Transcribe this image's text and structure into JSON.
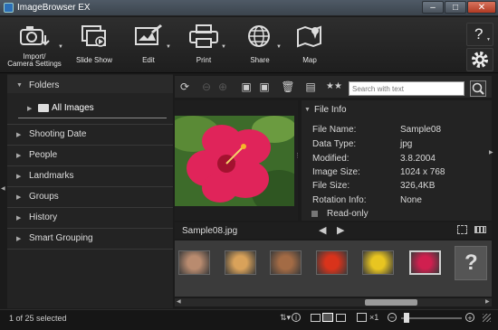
{
  "window": {
    "title": "ImageBrowser EX"
  },
  "toolbar": {
    "import_line1": "Import/",
    "import_line2": "Camera Settings",
    "slideshow": "Slide Show",
    "edit": "Edit",
    "print": "Print",
    "share": "Share",
    "map": "Map",
    "help": "?"
  },
  "sidebar": {
    "folders": "Folders",
    "all_images": "All Images",
    "items": [
      "Shooting Date",
      "People",
      "Landmarks",
      "Groups",
      "History",
      "Smart Grouping"
    ]
  },
  "search": {
    "placeholder": "Search with text"
  },
  "file_info": {
    "header": "File Info",
    "rows": [
      {
        "label": "File Name:",
        "value": "Sample08"
      },
      {
        "label": "Data Type:",
        "value": "jpg"
      },
      {
        "label": "Modified:",
        "value": "3.8.2004"
      },
      {
        "label": "Image Size:",
        "value": "1024 x 768"
      },
      {
        "label": "File Size:",
        "value": "326,4KB"
      },
      {
        "label": "Rotation Info:",
        "value": "None"
      }
    ],
    "readonly": "Read-only"
  },
  "preview": {
    "filename": "Sample08.jpg"
  },
  "thumbs": {
    "placeholder": "?",
    "selected_index": 5,
    "colors": [
      "#b98b6f",
      "#d9a25a",
      "#a36b45",
      "#d9331b",
      "#e8c521",
      "#d01f4f"
    ]
  },
  "status": {
    "selection": "1 of 25 selected",
    "zoom": "×1"
  },
  "colors": {
    "accent": "#2c6fb6",
    "background": "#1b1b1b",
    "panel": "#232323"
  }
}
